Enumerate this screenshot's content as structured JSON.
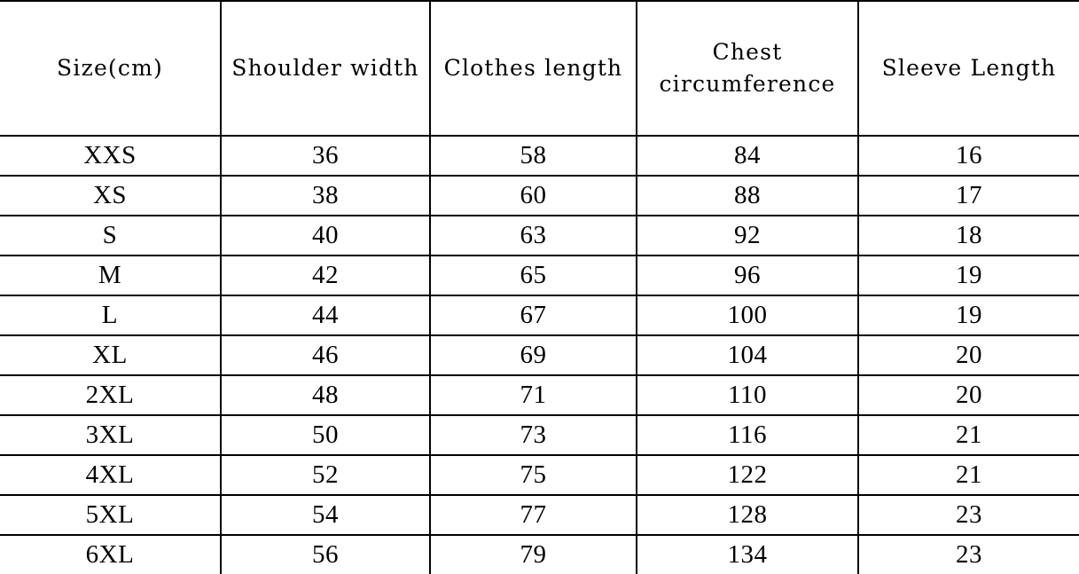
{
  "document": {
    "kind": "apparel-size-chart",
    "unit_note": "cm",
    "accent_color": "#000000",
    "background_color": "#ffffff",
    "border_color": "#000000"
  },
  "table": {
    "headers": [
      {
        "lines": [
          "Size(cm)"
        ]
      },
      {
        "lines": [
          "Shoulder width"
        ]
      },
      {
        "lines": [
          "Clothes length"
        ]
      },
      {
        "lines": [
          "Chest",
          "circumference"
        ]
      },
      {
        "lines": [
          "Sleeve Length"
        ]
      }
    ],
    "rows": [
      {
        "size": "XXS",
        "shoulder_width": "36",
        "clothes_length": "58",
        "chest_circumference": "84",
        "sleeve_length": "16"
      },
      {
        "size": "XS",
        "shoulder_width": "38",
        "clothes_length": "60",
        "chest_circumference": "88",
        "sleeve_length": "17"
      },
      {
        "size": "S",
        "shoulder_width": "40",
        "clothes_length": "63",
        "chest_circumference": "92",
        "sleeve_length": "18"
      },
      {
        "size": "M",
        "shoulder_width": "42",
        "clothes_length": "65",
        "chest_circumference": "96",
        "sleeve_length": "19"
      },
      {
        "size": "L",
        "shoulder_width": "44",
        "clothes_length": "67",
        "chest_circumference": "100",
        "sleeve_length": "19"
      },
      {
        "size": "XL",
        "shoulder_width": "46",
        "clothes_length": "69",
        "chest_circumference": "104",
        "sleeve_length": "20"
      },
      {
        "size": "2XL",
        "shoulder_width": "48",
        "clothes_length": "71",
        "chest_circumference": "110",
        "sleeve_length": "20"
      },
      {
        "size": "3XL",
        "shoulder_width": "50",
        "clothes_length": "73",
        "chest_circumference": "116",
        "sleeve_length": "21"
      },
      {
        "size": "4XL",
        "shoulder_width": "52",
        "clothes_length": "75",
        "chest_circumference": "122",
        "sleeve_length": "21"
      },
      {
        "size": "5XL",
        "shoulder_width": "54",
        "clothes_length": "77",
        "chest_circumference": "128",
        "sleeve_length": "23"
      },
      {
        "size": "6XL",
        "shoulder_width": "56",
        "clothes_length": "79",
        "chest_circumference": "134",
        "sleeve_length": "23"
      }
    ]
  },
  "chart_data": {
    "type": "table",
    "title": "",
    "columns": [
      "Size(cm)",
      "Shoulder width",
      "Clothes length",
      "Chest circumference",
      "Sleeve Length"
    ],
    "categories": [
      "XXS",
      "XS",
      "S",
      "M",
      "L",
      "XL",
      "2XL",
      "3XL",
      "4XL",
      "5XL",
      "6XL"
    ],
    "series": [
      {
        "name": "Shoulder width",
        "values": [
          36,
          38,
          40,
          42,
          44,
          46,
          48,
          50,
          52,
          54,
          56
        ]
      },
      {
        "name": "Clothes length",
        "values": [
          58,
          60,
          63,
          65,
          67,
          69,
          71,
          73,
          75,
          77,
          79
        ]
      },
      {
        "name": "Chest circumference",
        "values": [
          84,
          88,
          92,
          96,
          100,
          104,
          110,
          116,
          122,
          128,
          134
        ]
      },
      {
        "name": "Sleeve Length",
        "values": [
          16,
          17,
          18,
          19,
          19,
          20,
          20,
          21,
          21,
          23,
          23
        ]
      }
    ],
    "xlabel": "Size(cm)",
    "ylabel": "",
    "grid": true,
    "legend": "none"
  }
}
